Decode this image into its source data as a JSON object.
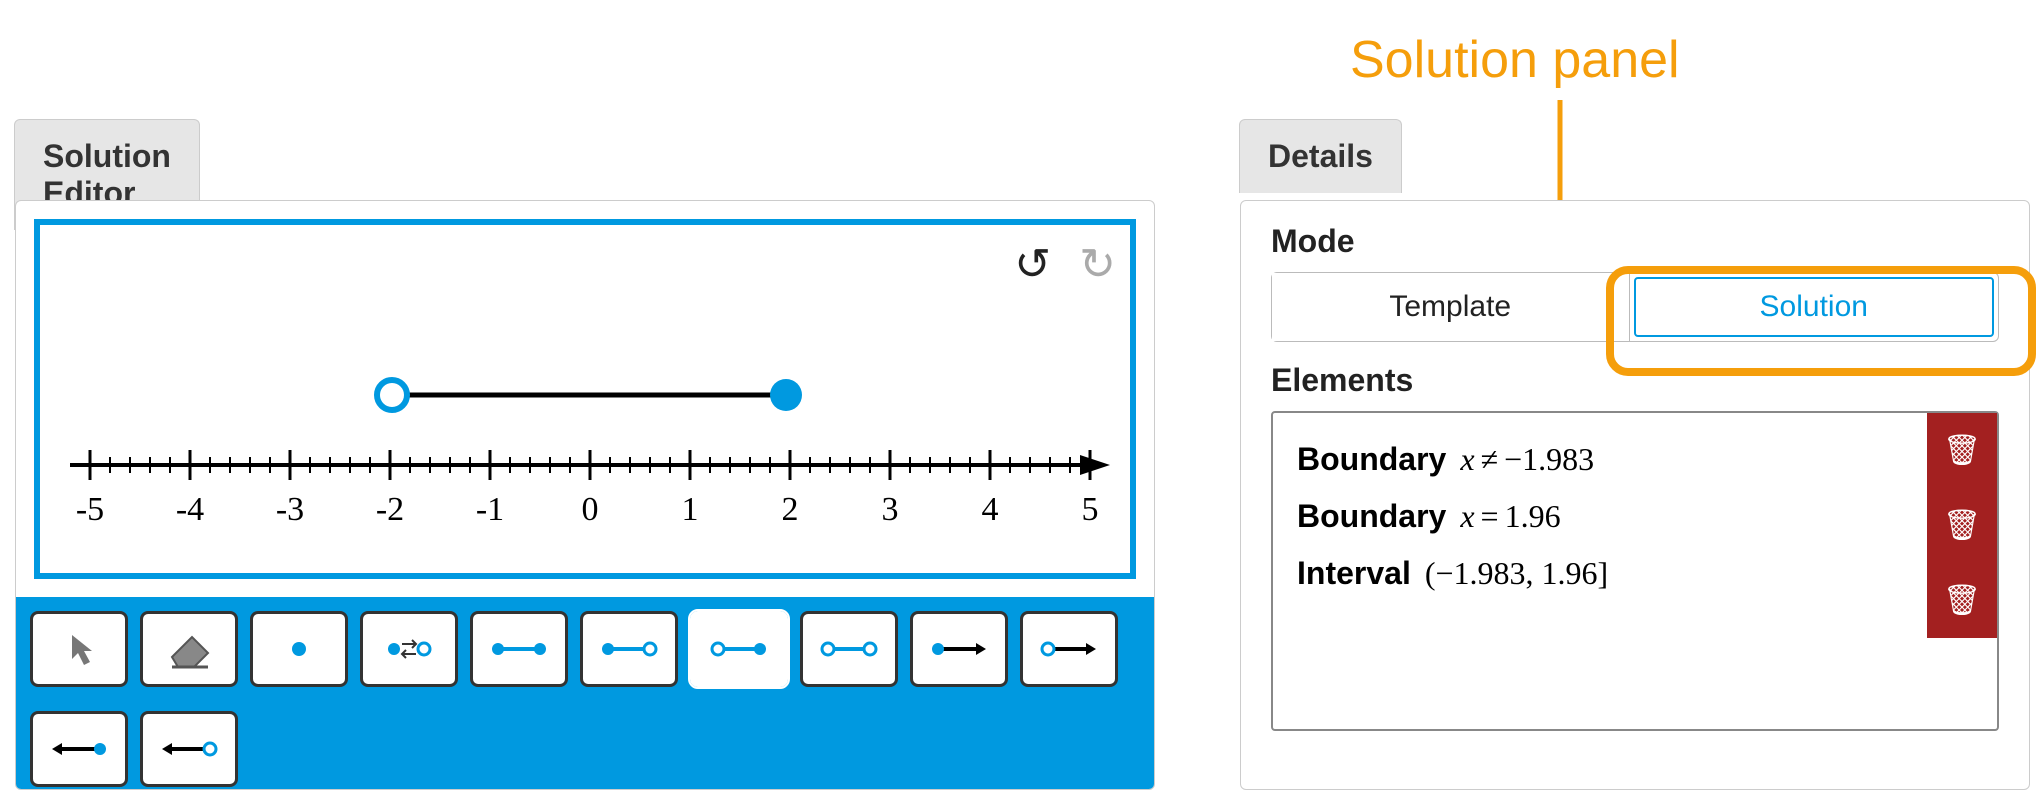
{
  "annotation": {
    "label": "Solution panel"
  },
  "editor": {
    "tab_title": "Solution Editor",
    "axis": {
      "min": -5,
      "max": 5,
      "ticks": [
        -5,
        -4,
        -3,
        -2,
        -1,
        0,
        1,
        2,
        3,
        4,
        5
      ]
    },
    "interval": {
      "left": -1.983,
      "left_open": true,
      "right": 1.96,
      "right_open": false
    },
    "tools": [
      {
        "id": "pointer-tool",
        "type": "pointer"
      },
      {
        "id": "eraser-tool",
        "type": "eraser"
      },
      {
        "id": "closed-point-tool",
        "type": "closed-point"
      },
      {
        "id": "toggle-point-tool",
        "type": "toggle-point"
      },
      {
        "id": "closed-closed-tool",
        "type": "cc"
      },
      {
        "id": "closed-open-tool",
        "type": "co"
      },
      {
        "id": "open-closed-tool",
        "type": "oc",
        "selected": true
      },
      {
        "id": "open-open-tool",
        "type": "oo"
      },
      {
        "id": "closed-ray-right-tool",
        "type": "cray-r"
      },
      {
        "id": "open-ray-right-tool",
        "type": "oray-r"
      },
      {
        "id": "closed-ray-left-tool",
        "type": "cray-l"
      },
      {
        "id": "open-ray-left-tool",
        "type": "oray-l"
      }
    ]
  },
  "details": {
    "tab_title": "Details",
    "mode_label": "Mode",
    "template_label": "Template",
    "solution_label": "Solution",
    "elements_label": "Elements",
    "elements": [
      {
        "kind": "Boundary",
        "var": "x",
        "op": "≠",
        "val": "−1.983"
      },
      {
        "kind": "Boundary",
        "var": "x",
        "op": "=",
        "val": "1.96"
      },
      {
        "kind": "Interval",
        "expr": "(−1.983, 1.96]"
      }
    ]
  },
  "colors": {
    "accent": "#0099e0",
    "highlight": "#f59e0b",
    "danger": "#a32020"
  }
}
